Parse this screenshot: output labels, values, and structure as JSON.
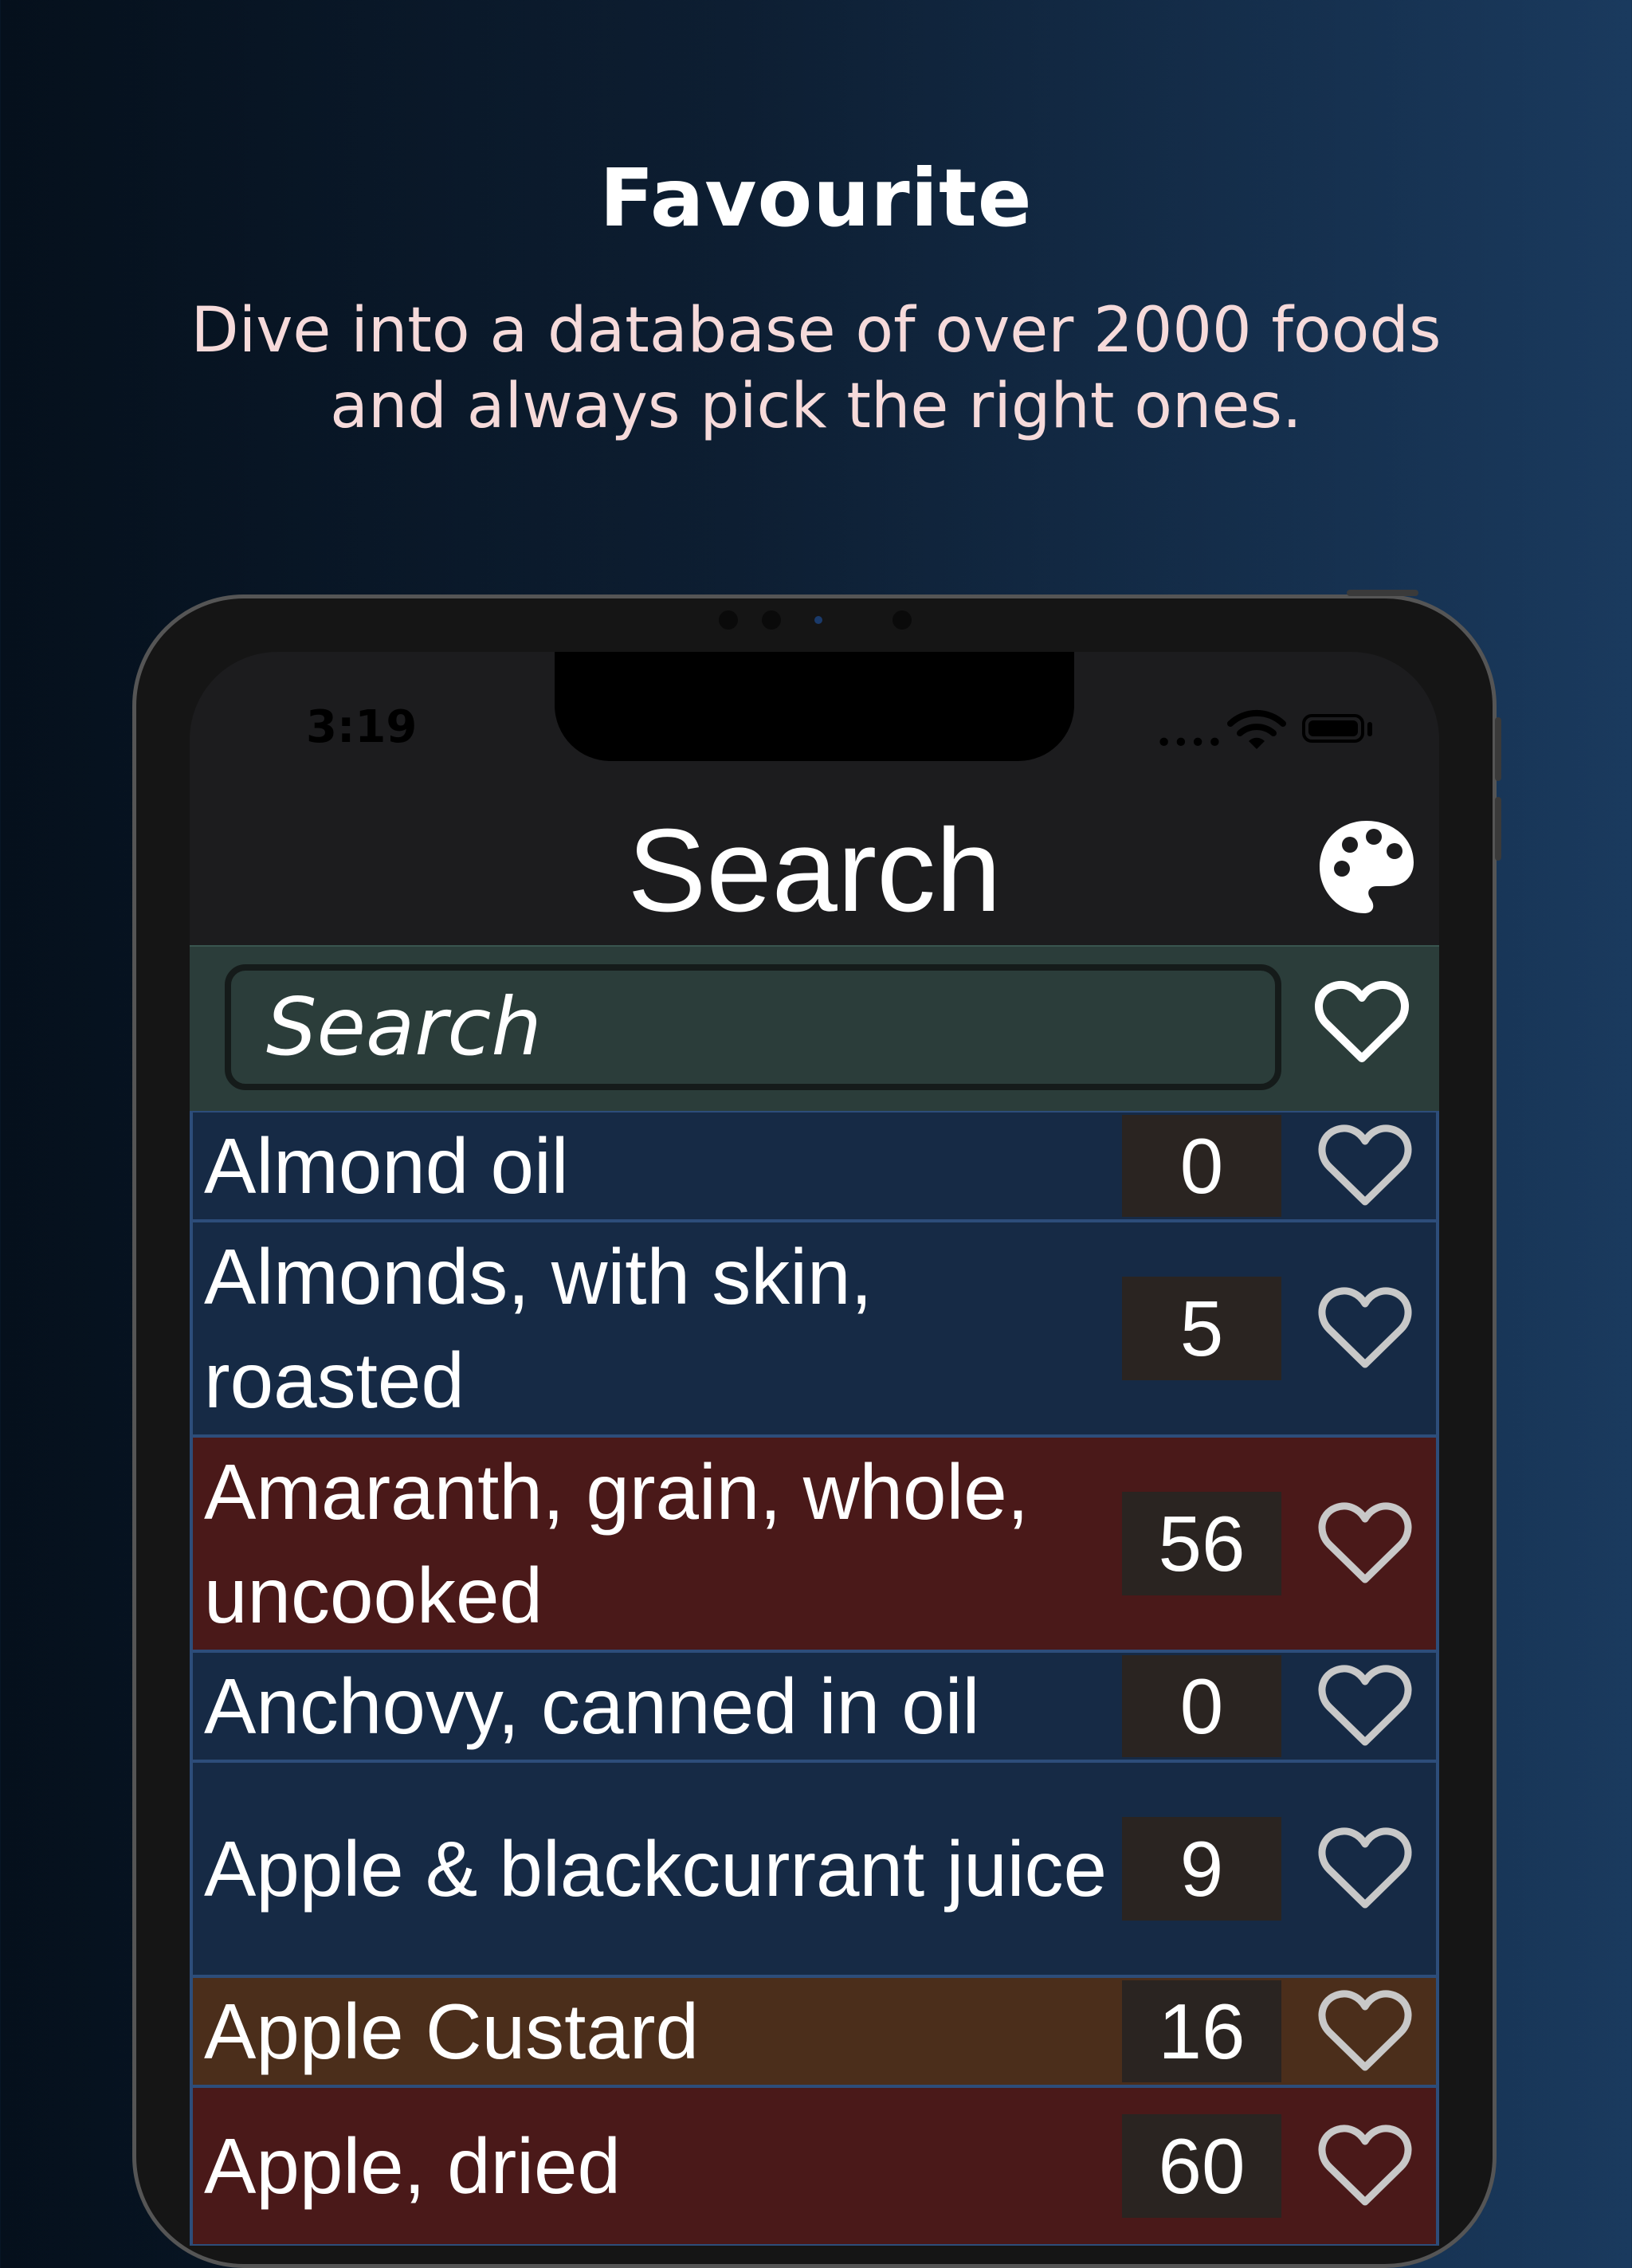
{
  "promo": {
    "title": "Favourite",
    "subtitle": "Dive into a database of over 2000 foods and always pick the right ones."
  },
  "status_bar": {
    "time": "3:19"
  },
  "nav": {
    "title": "Search",
    "palette_icon": "palette-icon"
  },
  "search": {
    "placeholder": "Search",
    "favorite_icon": "heart-outline-icon"
  },
  "foods": [
    {
      "name": "Almond oil",
      "value": "0",
      "color": "#162a45"
    },
    {
      "name": "Almonds, with skin, roasted",
      "value": "5",
      "color": "#162a45"
    },
    {
      "name": "Amaranth, grain, whole, uncooked",
      "value": "56",
      "color": "#4a1919"
    },
    {
      "name": "Anchovy, canned in oil",
      "value": "0",
      "color": "#162a45"
    },
    {
      "name": "Apple & blackcurrant juice",
      "value": "9",
      "color": "#162a45"
    },
    {
      "name": "Apple Custard",
      "value": "16",
      "color": "#4b2e1b"
    },
    {
      "name": "Apple, dried",
      "value": "60",
      "color": "#4a1919"
    }
  ],
  "colors": {
    "low_gi": "#162a45",
    "medium_gi": "#4b2e1b",
    "high_gi": "#4a1919",
    "search_bg": "#2b3d3a"
  }
}
